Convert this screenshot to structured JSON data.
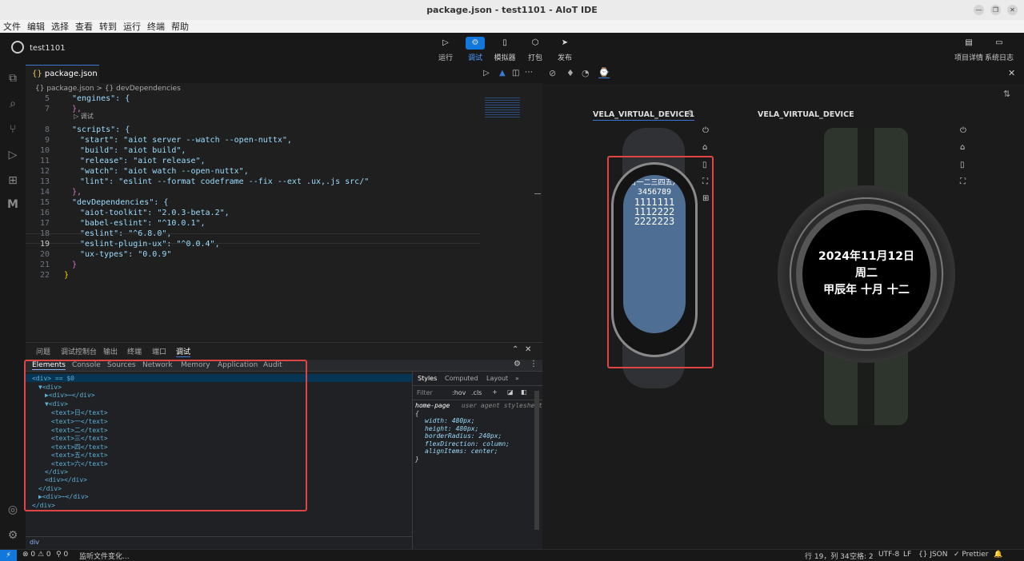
{
  "window": {
    "title": "package.json - test1101 - AIoT IDE"
  },
  "menu": [
    "文件",
    "编辑",
    "选择",
    "查看",
    "转到",
    "运行",
    "终端",
    "帮助"
  ],
  "project": {
    "name": "test1101"
  },
  "toolbar": {
    "items": [
      {
        "label": "运行",
        "icon": "play-icon"
      },
      {
        "label": "调试",
        "icon": "bug-icon",
        "active": true
      },
      {
        "label": "模拟器",
        "icon": "device-icon"
      },
      {
        "label": "打包",
        "icon": "package-icon"
      },
      {
        "label": "发布",
        "icon": "send-icon"
      }
    ],
    "right": [
      {
        "label": "项目详情",
        "icon": "doc-icon"
      },
      {
        "label": "系统日志",
        "icon": "folder-icon"
      }
    ]
  },
  "editor": {
    "tab": "package.json",
    "breadcrumb": "{} package.json > {} devDependencies",
    "codelens": "▷ 调试",
    "lines": [
      {
        "n": "5",
        "t": "\"engines\": {"
      },
      {
        "n": "7",
        "t": "},"
      },
      {
        "n": "8",
        "t": "\"scripts\": {"
      },
      {
        "n": "9",
        "t": "\"start\": \"aiot server --watch --open-nuttx\","
      },
      {
        "n": "10",
        "t": "\"build\": \"aiot build\","
      },
      {
        "n": "11",
        "t": "\"release\": \"aiot release\","
      },
      {
        "n": "12",
        "t": "\"watch\": \"aiot watch --open-nuttx\","
      },
      {
        "n": "13",
        "t": "\"lint\": \"eslint --format codeframe --fix --ext .ux,.js src/\""
      },
      {
        "n": "14",
        "t": "},"
      },
      {
        "n": "15",
        "t": "\"devDependencies\": {"
      },
      {
        "n": "16",
        "t": "\"aiot-toolkit\": \"2.0.3-beta.2\","
      },
      {
        "n": "17",
        "t": "\"babel-eslint\": \"^10.0.1\","
      },
      {
        "n": "18",
        "t": "\"eslint\": \"^6.8.0\","
      },
      {
        "n": "19",
        "t": "\"eslint-plugin-ux\": \"^0.0.4\","
      },
      {
        "n": "20",
        "t": "\"ux-types\": \"0.0.9\""
      },
      {
        "n": "21",
        "t": "}"
      },
      {
        "n": "22",
        "t": "}"
      }
    ]
  },
  "panel": {
    "tabs": [
      "问题",
      "调试控制台",
      "输出",
      "终端",
      "端口",
      "调试"
    ],
    "active": "调试"
  },
  "devtools": {
    "tabs": [
      "Elements",
      "Console",
      "Sources",
      "Network",
      "Memory",
      "Application",
      "Audit"
    ],
    "dom": [
      "<div> == $0",
      "▼<div>",
      "▶<div>⋯</div>",
      "▼<div>",
      "<text>日</text>",
      "<text>一</text>",
      "<text>二</text>",
      "<text>三</text>",
      "<text>四</text>",
      "<text>五</text>",
      "<text>六</text>",
      "</div>",
      "<div></div>",
      "</div>",
      "▶<div>⋯</div>",
      "</div>"
    ],
    "bottom_crumb": "div",
    "styles_tabs": [
      "Styles",
      "Computed",
      "Layout",
      "»"
    ],
    "filter_placeholder": "Filter",
    "hov": ":hov",
    "cls": ".cls",
    "selector": "home-page",
    "ua": "user agent stylesheet",
    "brace_open": "{",
    "brace_close": "}",
    "rules": [
      "width: 480px;",
      "height: 480px;",
      "borderRadius: 240px;",
      "flexDirection: column;",
      "alignItems: center;"
    ]
  },
  "devices": {
    "d1": {
      "name": "VELA_VIRTUAL_DEVICE1",
      "screen_rows": [
        "日一二三四五六",
        "3456789",
        "1111111",
        "1112222",
        "2222223"
      ]
    },
    "d2": {
      "name": "VELA_VIRTUAL_DEVICE",
      "date": "2024年11月12日",
      "weekday": "周二",
      "lunar": "甲辰年 十月 十二"
    }
  },
  "status": {
    "problems": "⊗ 0 ⚠ 0",
    "ports": "⚲ 0",
    "watch": "监听文件变化...",
    "pos": "行 19，列 34",
    "spaces": "空格: 2",
    "encoding": "UTF-8",
    "eol": "LF",
    "lang": "{} JSON",
    "prettier": "✓ Prettier"
  },
  "colors": {
    "accent": "#1177dd",
    "highlight": "#e04444",
    "screen": "#4f6e94"
  }
}
